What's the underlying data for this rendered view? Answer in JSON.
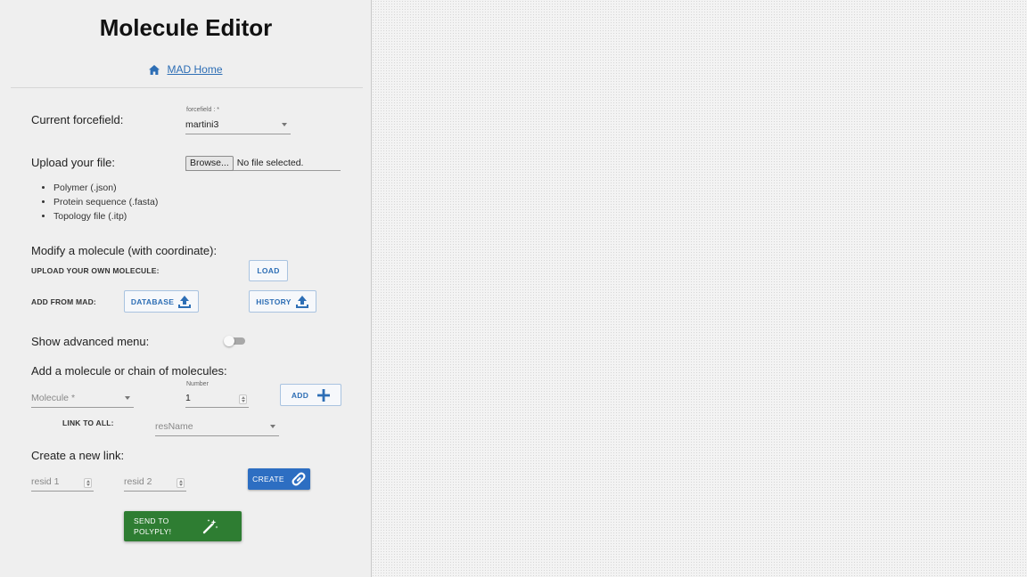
{
  "header": {
    "title": "Molecule Editor",
    "home_link": "MAD Home",
    "home_icon": "home-icon"
  },
  "forcefield": {
    "label": "Current forcefield:",
    "field_label": "forcefield : *",
    "value": "martini3"
  },
  "upload": {
    "label": "Upload your file:",
    "browse_label": "Browse...",
    "file_status": "No file selected.",
    "accepted_types": [
      "Polymer (.json)",
      "Protein sequence (.fasta)",
      "Topology file (.itp)"
    ]
  },
  "modify": {
    "heading": "Modify a molecule (with coordinate):",
    "upload_own_label": "UPLOAD YOUR OWN MOLECULE:",
    "load_button": "LOAD",
    "add_from_mad_label": "ADD FROM MAD:",
    "database_button": "DATABASE",
    "history_button": "HISTORY",
    "button_icon": "upload-icon",
    "accent_color": "#2d6eb5"
  },
  "advanced": {
    "label": "Show advanced menu:",
    "enabled": false
  },
  "add_molecule": {
    "heading": "Add a molecule or chain of molecules:",
    "molecule_placeholder": "Molecule *",
    "number_label": "Number",
    "number_value": "1",
    "add_button": "ADD",
    "link_to_all_label": "LINK TO ALL:",
    "resname_placeholder": "resName"
  },
  "new_link": {
    "heading": "Create a new link:",
    "resid1_placeholder": "resid 1",
    "resid2_placeholder": "resid 2",
    "create_button": "CREATE",
    "create_color": "#2d6ec2"
  },
  "send": {
    "button": "SEND TO POLYPLY!",
    "color": "#2e7d32"
  }
}
